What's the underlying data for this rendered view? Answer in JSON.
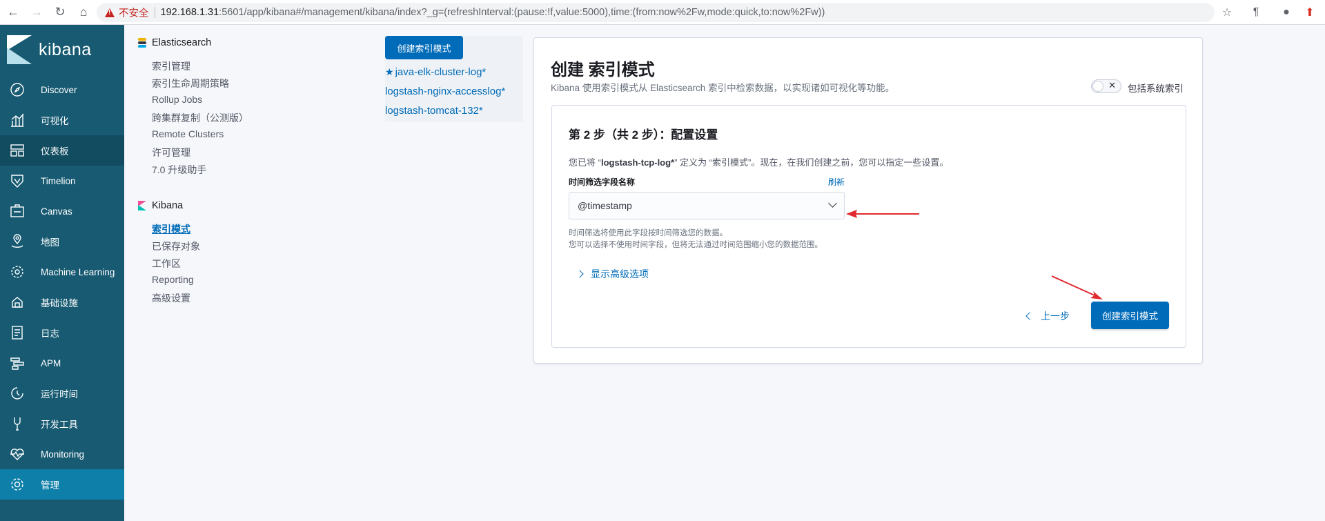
{
  "browser": {
    "insecure_label": "不安全",
    "url_host": "192.168.1.31",
    "url_rest": ":5601/app/kibana#/management/kibana/index?_g=(refreshInterval:(pause:!f,value:5000),time:(from:now%2Fw,mode:quick,to:now%2Fw))"
  },
  "kibana": {
    "logo_text": "kibana",
    "nav_items": [
      {
        "label": "Discover",
        "icon": "compass-icon"
      },
      {
        "label": "可视化",
        "icon": "visualize-icon"
      },
      {
        "label": "仪表板",
        "icon": "dashboard-icon"
      },
      {
        "label": "Timelion",
        "icon": "timelion-icon"
      },
      {
        "label": "Canvas",
        "icon": "canvas-icon"
      },
      {
        "label": "地图",
        "icon": "map-icon"
      },
      {
        "label": "Machine Learning",
        "icon": "machine-learning-icon"
      },
      {
        "label": "基础设施",
        "icon": "infrastructure-icon"
      },
      {
        "label": "日志",
        "icon": "logs-icon"
      },
      {
        "label": "APM",
        "icon": "apm-icon"
      },
      {
        "label": "运行时间",
        "icon": "uptime-icon"
      },
      {
        "label": "开发工具",
        "icon": "dev-tools-icon"
      },
      {
        "label": "Monitoring",
        "icon": "monitoring-icon"
      },
      {
        "label": "管理",
        "icon": "gear-icon"
      }
    ]
  },
  "management": {
    "elasticsearch_title": "Elasticsearch",
    "elasticsearch_links": [
      "索引管理",
      "索引生命周期策略",
      "Rollup Jobs",
      "跨集群复制（公测版）",
      "Remote Clusters",
      "许可管理",
      "7.0 升级助手"
    ],
    "kibana_title": "Kibana",
    "kibana_links": [
      "索引模式",
      "已保存对象",
      "工作区",
      "Reporting",
      "高级设置"
    ]
  },
  "patterns": {
    "create_button": "创建索引模式",
    "items": [
      "java-elk-cluster-log*",
      "logstash-nginx-accesslog*",
      "logstash-tomcat-132*"
    ]
  },
  "main": {
    "title": "创建 索引模式",
    "description": "Kibana 使用索引模式从 Elasticsearch 索引中检索数据，以实现诸如可视化等功能。",
    "include_system_label": "包括系统索引",
    "step_title": "第 2 步（共 2 步）：配置设置",
    "step_desc_prefix": "您已将 “",
    "step_desc_pattern": "logstash-tcp-log*",
    "step_desc_suffix": "” 定义为 “索引模式”。现在，在我们创建之前，您可以指定一些设置。",
    "field_label": "时间筛选字段名称",
    "refresh_label": "刷新",
    "time_field_value": "@timestamp",
    "help_line1": "时间筛选将使用此字段按时间筛选您的数据。",
    "help_line2": "您可以选择不使用时间字段，但将无法通过时间范围缩小您的数据范围。",
    "advanced_label": "显示高级选项",
    "back_label": "上一步",
    "create_label": "创建索引模式"
  },
  "colors": {
    "sidebar": "#175a72",
    "accent": "#006bb8",
    "annotation": "#e0282e"
  }
}
